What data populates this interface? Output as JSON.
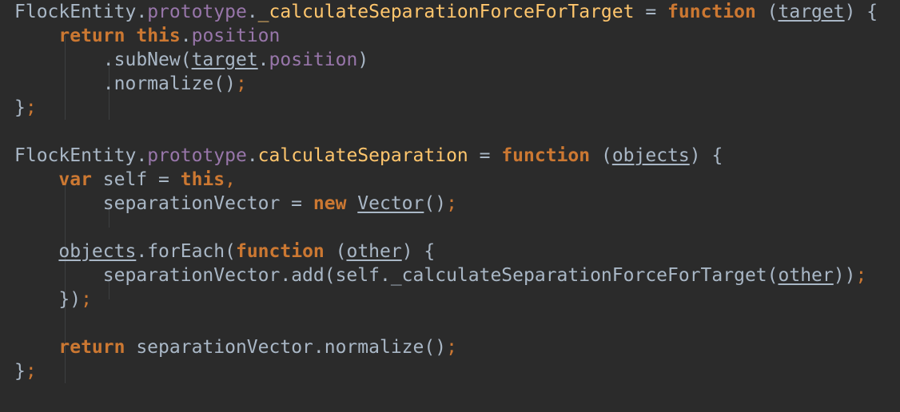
{
  "editor": {
    "theme_colors": {
      "background": "#2b2b2b",
      "default": "#a9b7c6",
      "keyword": "#cc7832",
      "field": "#9876aa",
      "function_decl": "#ffc66d",
      "punctuation": "#cc7832"
    },
    "lines": [
      [
        {
          "text": "FlockEntity",
          "kind": "default"
        },
        {
          "text": ".",
          "kind": "default"
        },
        {
          "text": "prototype",
          "kind": "field"
        },
        {
          "text": ".",
          "kind": "default"
        },
        {
          "text": "_calculateSeparationForceForTarget",
          "kind": "func"
        },
        {
          "text": " = ",
          "kind": "default"
        },
        {
          "text": "function",
          "kind": "keyword"
        },
        {
          "text": " (",
          "kind": "default"
        },
        {
          "text": "target",
          "kind": "param"
        },
        {
          "text": ") {",
          "kind": "default"
        }
      ],
      [
        {
          "text": "    ",
          "kind": "default"
        },
        {
          "text": "return",
          "kind": "keyword"
        },
        {
          "text": " ",
          "kind": "default"
        },
        {
          "text": "this",
          "kind": "keyword"
        },
        {
          "text": ".",
          "kind": "default"
        },
        {
          "text": "position",
          "kind": "field"
        }
      ],
      [
        {
          "text": "        .",
          "kind": "default"
        },
        {
          "text": "subNew",
          "kind": "default"
        },
        {
          "text": "(",
          "kind": "default"
        },
        {
          "text": "target",
          "kind": "param"
        },
        {
          "text": ".",
          "kind": "default"
        },
        {
          "text": "position",
          "kind": "field"
        },
        {
          "text": ")",
          "kind": "default"
        }
      ],
      [
        {
          "text": "        .",
          "kind": "default"
        },
        {
          "text": "normalize",
          "kind": "default"
        },
        {
          "text": "()",
          "kind": "default"
        },
        {
          "text": ";",
          "kind": "punct"
        }
      ],
      [
        {
          "text": "}",
          "kind": "default"
        },
        {
          "text": ";",
          "kind": "punct"
        }
      ],
      [],
      [
        {
          "text": "FlockEntity",
          "kind": "default"
        },
        {
          "text": ".",
          "kind": "default"
        },
        {
          "text": "prototype",
          "kind": "field"
        },
        {
          "text": ".",
          "kind": "default"
        },
        {
          "text": "calculateSeparation",
          "kind": "func"
        },
        {
          "text": " = ",
          "kind": "default"
        },
        {
          "text": "function",
          "kind": "keyword"
        },
        {
          "text": " (",
          "kind": "default"
        },
        {
          "text": "objects",
          "kind": "param"
        },
        {
          "text": ") {",
          "kind": "default"
        }
      ],
      [
        {
          "text": "    ",
          "kind": "default"
        },
        {
          "text": "var",
          "kind": "keyword"
        },
        {
          "text": " self = ",
          "kind": "default"
        },
        {
          "text": "this",
          "kind": "keyword"
        },
        {
          "text": ",",
          "kind": "punct"
        }
      ],
      [
        {
          "text": "        separationVector = ",
          "kind": "default"
        },
        {
          "text": "new",
          "kind": "keyword"
        },
        {
          "text": " ",
          "kind": "default"
        },
        {
          "text": "Vector",
          "kind": "param"
        },
        {
          "text": "()",
          "kind": "default"
        },
        {
          "text": ";",
          "kind": "punct"
        }
      ],
      [],
      [
        {
          "text": "    ",
          "kind": "default"
        },
        {
          "text": "objects",
          "kind": "param"
        },
        {
          "text": ".",
          "kind": "default"
        },
        {
          "text": "forEach",
          "kind": "default"
        },
        {
          "text": "(",
          "kind": "default"
        },
        {
          "text": "function",
          "kind": "keyword"
        },
        {
          "text": " (",
          "kind": "default"
        },
        {
          "text": "other",
          "kind": "param"
        },
        {
          "text": ") {",
          "kind": "default"
        }
      ],
      [
        {
          "text": "        separationVector.",
          "kind": "default"
        },
        {
          "text": "add",
          "kind": "default"
        },
        {
          "text": "(self.",
          "kind": "default"
        },
        {
          "text": "_calculateSeparationForceForTarget",
          "kind": "default"
        },
        {
          "text": "(",
          "kind": "default"
        },
        {
          "text": "other",
          "kind": "param"
        },
        {
          "text": "))",
          "kind": "default"
        },
        {
          "text": ";",
          "kind": "punct"
        }
      ],
      [
        {
          "text": "    })",
          "kind": "default"
        },
        {
          "text": ";",
          "kind": "punct"
        }
      ],
      [],
      [
        {
          "text": "    ",
          "kind": "default"
        },
        {
          "text": "return",
          "kind": "keyword"
        },
        {
          "text": " separationVector.",
          "kind": "default"
        },
        {
          "text": "normalize",
          "kind": "default"
        },
        {
          "text": "()",
          "kind": "default"
        },
        {
          "text": ";",
          "kind": "punct"
        }
      ],
      [
        {
          "text": "}",
          "kind": "default"
        },
        {
          "text": ";",
          "kind": "punct"
        }
      ]
    ]
  }
}
